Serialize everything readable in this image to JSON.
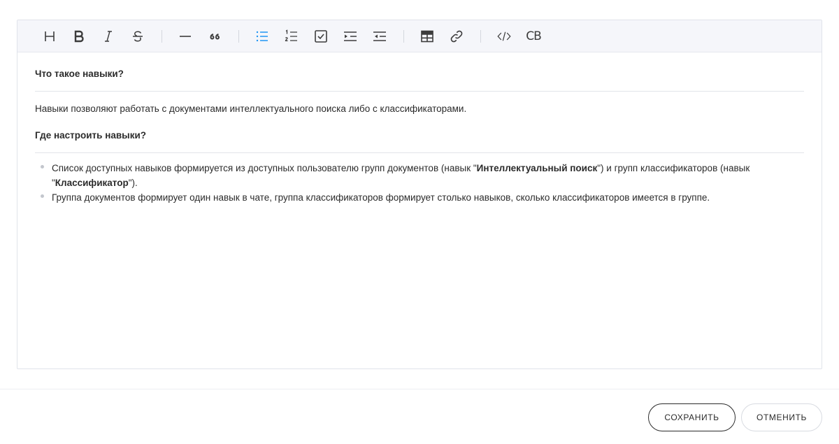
{
  "toolbar": {
    "buttons": [
      {
        "name": "heading",
        "icon": "heading-icon",
        "label": "H"
      },
      {
        "name": "bold",
        "icon": "bold-icon",
        "label": "B"
      },
      {
        "name": "italic",
        "icon": "italic-icon",
        "label": "I"
      },
      {
        "name": "strikethrough",
        "icon": "strikethrough-icon",
        "label": "S"
      },
      {
        "name": "horizontal-rule",
        "icon": "horizontal-rule-icon"
      },
      {
        "name": "blockquote",
        "icon": "quote-icon",
        "label": "66"
      },
      {
        "name": "bullet-list",
        "icon": "bullet-list-icon",
        "active": true
      },
      {
        "name": "ordered-list",
        "icon": "ordered-list-icon"
      },
      {
        "name": "task-list",
        "icon": "checkbox-icon"
      },
      {
        "name": "indent",
        "icon": "indent-icon"
      },
      {
        "name": "outdent",
        "icon": "outdent-icon"
      },
      {
        "name": "table",
        "icon": "table-icon"
      },
      {
        "name": "link",
        "icon": "link-icon"
      },
      {
        "name": "code",
        "icon": "code-icon",
        "label": "</>"
      },
      {
        "name": "code-block",
        "icon": "code-block-icon",
        "label": "CB"
      }
    ],
    "active_color": "#2196f3"
  },
  "content": {
    "heading1": "Что такое навыки?",
    "paragraph1": "Навыки позволяют работать с документами интеллектуального поиска либо с классификаторами.",
    "heading2": "Где настроить навыки?",
    "list": [
      {
        "t1": "Список доступных навыков формируется из доступных пользователю групп документов (навык \"",
        "b1": "Интеллектуальный поиск",
        "t2": "\") и групп классификаторов (навык \"",
        "b2": "Классификатор",
        "t3": "\")."
      },
      {
        "t1": "Группа документов формирует один навык в чате, группа классификаторов формирует столько навыков, сколько классификаторов имеется в группе."
      }
    ]
  },
  "footer": {
    "save_label": "СОХРАНИТЬ",
    "cancel_label": "ОТМЕНИТЬ"
  }
}
